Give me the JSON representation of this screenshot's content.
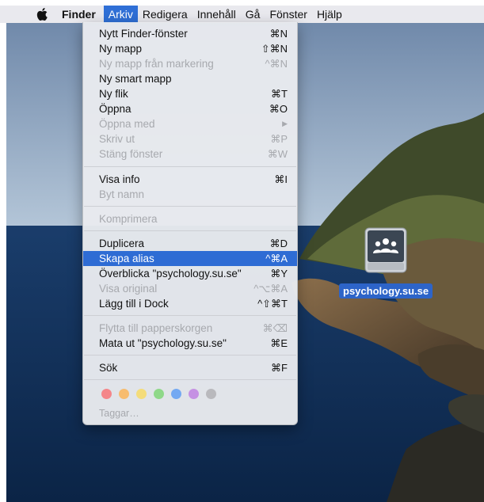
{
  "menubar": {
    "app": "Finder",
    "items": [
      "Arkiv",
      "Redigera",
      "Innehåll",
      "Gå",
      "Fönster",
      "Hjälp"
    ],
    "active": "Arkiv"
  },
  "menu": {
    "items": [
      {
        "label": "Nytt Finder-fönster",
        "shortcut": "⌘N"
      },
      {
        "label": "Ny mapp",
        "shortcut": "⇧⌘N"
      },
      {
        "label": "Ny mapp från markering",
        "shortcut": "^⌘N"
      },
      {
        "label": "Ny smart mapp",
        "shortcut": ""
      },
      {
        "label": "Ny flik",
        "shortcut": "⌘T"
      },
      {
        "label": "Öppna",
        "shortcut": "⌘O"
      },
      {
        "label": "Öppna med",
        "shortcut": "▶"
      },
      {
        "label": "Skriv ut",
        "shortcut": "⌘P"
      },
      {
        "label": "Stäng fönster",
        "shortcut": "⌘W"
      },
      {
        "label": "Visa info",
        "shortcut": "⌘I"
      },
      {
        "label": "Byt namn",
        "shortcut": ""
      },
      {
        "label": "Komprimera",
        "shortcut": ""
      },
      {
        "label": "Duplicera",
        "shortcut": "⌘D"
      },
      {
        "label": "Skapa alias",
        "shortcut": "^⌘A"
      },
      {
        "label": "Överblicka \"psychology.su.se\"",
        "shortcut": "⌘Y"
      },
      {
        "label": "Visa original",
        "shortcut": "^⌥⌘A"
      },
      {
        "label": "Lägg till i Dock",
        "shortcut": "^⇧⌘T"
      },
      {
        "label": "Flytta till papperskorgen",
        "shortcut": "⌘⌫"
      },
      {
        "label": "Mata ut \"psychology.su.se\"",
        "shortcut": "⌘E"
      },
      {
        "label": "Sök",
        "shortcut": "⌘F"
      }
    ],
    "tags_label": "Taggar…",
    "tag_colors": [
      "#f4868a",
      "#f7bc6f",
      "#f4dc7a",
      "#8fd889",
      "#74a9f2",
      "#c591e3",
      "#b9b9bd"
    ]
  },
  "desktop": {
    "drive_label": "psychology.su.se"
  },
  "colors": {
    "menubar": "#e9e9ee",
    "highlight": "#2e6cd4",
    "disabled_text": "#a7a9ae"
  }
}
